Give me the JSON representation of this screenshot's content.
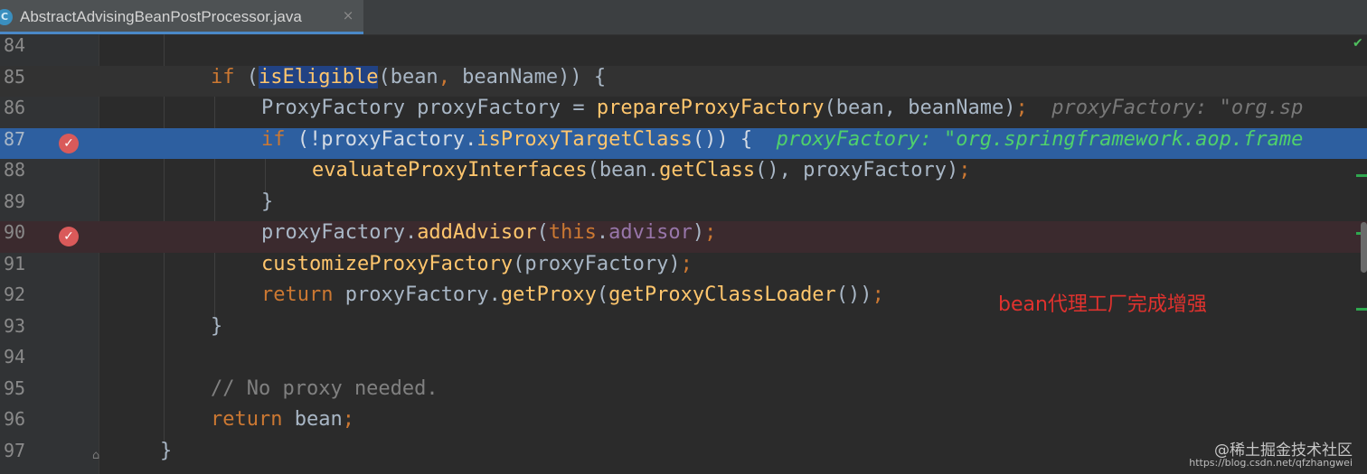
{
  "tab": {
    "icon": "C",
    "title": "AbstractAdvisingBeanPostProcessor.java",
    "close": "×"
  },
  "lines": [
    {
      "num": "84"
    },
    {
      "num": "85",
      "t": [
        "if",
        " (",
        "isEligible",
        "(bean",
        ",",
        " beanName)) {"
      ]
    },
    {
      "num": "86",
      "t": [
        "ProxyFactory proxyFactory = ",
        "prepareProxyFactory",
        "(bean, beanName)",
        ";",
        "proxyFactory: \"org.sp"
      ]
    },
    {
      "num": "87",
      "t": [
        "if",
        " (!proxyFactory.",
        "isProxyTargetClass",
        "()) {",
        "proxyFactory: \"org.springframework.aop.frame"
      ]
    },
    {
      "num": "88",
      "t": [
        "evaluateProxyInterfaces",
        "(bean.",
        "getClass",
        "(), proxyFactory)",
        ";"
      ]
    },
    {
      "num": "89",
      "t": [
        "}"
      ]
    },
    {
      "num": "90",
      "t": [
        "proxyFactory.",
        "addAdvisor",
        "(",
        "this",
        ".",
        "advisor",
        ")",
        ";"
      ]
    },
    {
      "num": "91",
      "t": [
        "customizeProxyFactory",
        "(proxyFactory)",
        ";"
      ]
    },
    {
      "num": "92",
      "t": [
        "return",
        " proxyFactory.",
        "getProxy",
        "(",
        "getProxyClassLoader",
        "())",
        ";"
      ]
    },
    {
      "num": "93",
      "t": [
        "}"
      ]
    },
    {
      "num": "94"
    },
    {
      "num": "95",
      "t": [
        "// No proxy needed."
      ]
    },
    {
      "num": "96",
      "t": [
        "return",
        " bean",
        ";"
      ]
    },
    {
      "num": "97",
      "t": [
        "}"
      ]
    }
  ],
  "annotation": "bean代理工厂完成增强",
  "watermark": "@稀土掘金技术社区",
  "watermark_url": "https://blog.csdn.net/qfzhangwei",
  "colors": {
    "background": "#2b2b2b",
    "selected_line": "#2d5fa0",
    "breakpoint_line": "#3b2a2e",
    "keyword": "#cc7832",
    "method": "#ffc66d",
    "field": "#9876aa",
    "inlay_value": "#4fd16b",
    "annotation": "#e0322e"
  },
  "icons": {
    "breakpoint": "breakpoint-check-icon",
    "file": "java-class-icon"
  }
}
